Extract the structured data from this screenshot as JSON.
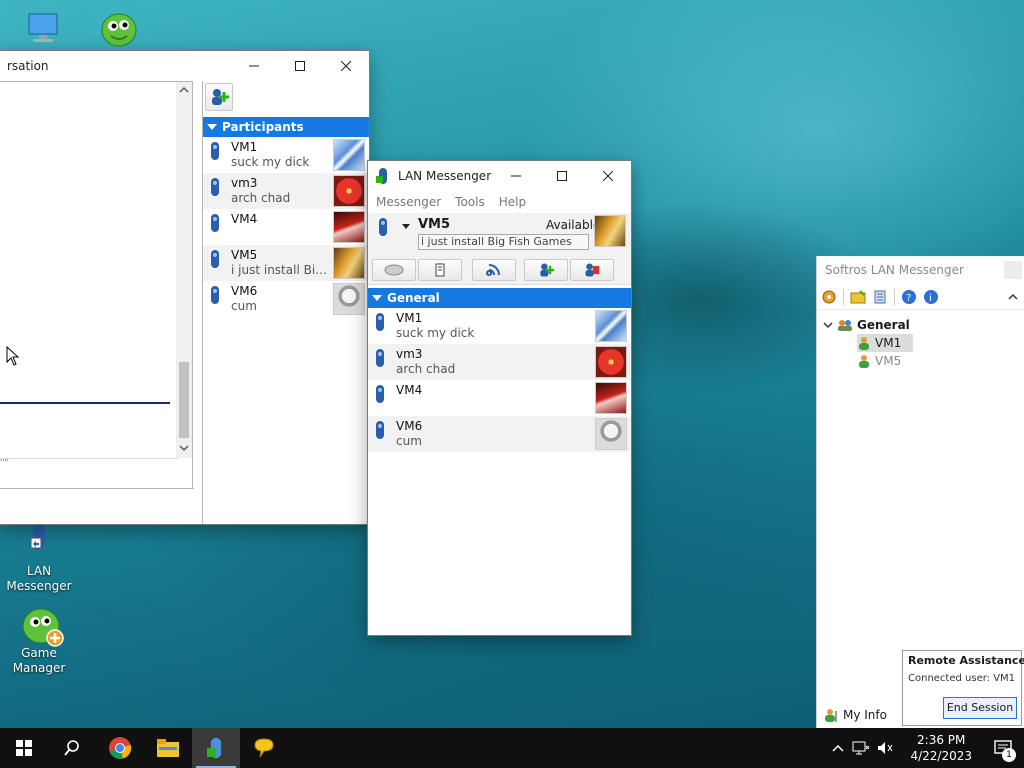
{
  "desktop": {
    "icons": [
      {
        "label": "LAN Messenger"
      },
      {
        "label": "Game Manager"
      }
    ]
  },
  "conversation_window": {
    "title": "rsation",
    "participants_header": "Participants",
    "participants": [
      {
        "name": "VM1",
        "note": "suck my dick"
      },
      {
        "name": "vm3",
        "note": "arch chad"
      },
      {
        "name": "VM4",
        "note": ""
      },
      {
        "name": "VM5",
        "note": "i just install Big F..."
      },
      {
        "name": "VM6",
        "note": "cum"
      }
    ]
  },
  "lan_messenger": {
    "title": "LAN Messenger",
    "menu": [
      "Messenger",
      "Tools",
      "Help"
    ],
    "user": {
      "name": "VM5",
      "status": "Available",
      "note": "i just install Big Fish Games"
    },
    "group_header": "General",
    "contacts": [
      {
        "name": "VM1",
        "note": "suck my dick"
      },
      {
        "name": "vm3",
        "note": "arch chad"
      },
      {
        "name": "VM4",
        "note": ""
      },
      {
        "name": "VM6",
        "note": "cum"
      }
    ]
  },
  "softros": {
    "title": "Softros LAN Messenger",
    "group": "General",
    "users": [
      "VM1",
      "VM5"
    ],
    "my_info": "My Info"
  },
  "remote_assistance": {
    "title": "Remote Assistance",
    "connected": "Connected user: VM1",
    "end_button": "End Session"
  },
  "taskbar": {
    "time": "2:36 PM",
    "date": "4/22/2023",
    "notif_count": "1"
  },
  "colors": {
    "accent": "#1479e0",
    "taskbar": "#101010"
  }
}
